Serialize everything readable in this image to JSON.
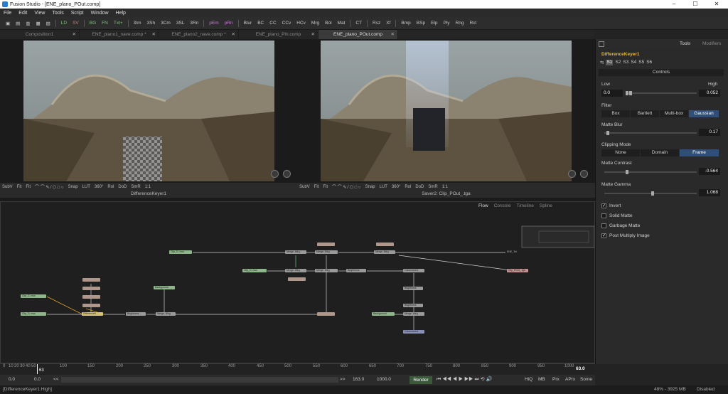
{
  "app": {
    "title": "Fusion Studio - [ENE_plano_POut.comp]"
  },
  "window_controls": [
    "–",
    "☐",
    "✕"
  ],
  "menu": [
    "File",
    "Edit",
    "View",
    "Tools",
    "Script",
    "Window",
    "Help"
  ],
  "toolbar": [
    "LD",
    "SV",
    "BG",
    "FN",
    "Txt+",
    "3Im",
    "3Sh",
    "3Cm",
    "3SL",
    "3Rn",
    "pEm",
    "pRn",
    "Blur",
    "BC",
    "CC",
    "CCv",
    "HCv",
    "Mrg",
    "Bol",
    "Mat",
    "CT",
    "Rsz",
    "Xf",
    "Bmp",
    "BSp",
    "Elp",
    "Ply",
    "Rng",
    "Rct"
  ],
  "tabs": [
    {
      "label": "Composition1"
    },
    {
      "label": "ENE_plano1_nave.comp *"
    },
    {
      "label": "ENE_plano2_nave.comp *"
    },
    {
      "label": "ENE_plano_Pln.comp"
    },
    {
      "label": "ENE_plano_POut.comp"
    }
  ],
  "viewer_left": {
    "label": "DifferenceKeyer1",
    "tools": [
      "SubV",
      "Fit",
      "Fit",
      "Snap",
      "LUT",
      "360°",
      "Rol",
      "DoD",
      "SmR",
      "1:1"
    ]
  },
  "viewer_right": {
    "label": "Saver2: Clip_POut_.tga",
    "tools": [
      "SubV",
      "Fit",
      "Fit",
      "Snap",
      "LUT",
      "360°",
      "Rol",
      "DoD",
      "SmR",
      "1:1"
    ]
  },
  "flow": {
    "tabs": [
      "Flow",
      "Console",
      "Timeline",
      "Spline"
    ],
    "nodes": [
      {
        "label": "Clip_D..mov",
        "color": "green"
      },
      {
        "label": "Clip_D..mov",
        "color": "green"
      },
      {
        "label": "Clip_D..mov",
        "color": "green"
      },
      {
        "label": "Clip_D..mov",
        "color": "green"
      },
      {
        "label": "DifferenceK...",
        "color": "yel"
      },
      {
        "label": "Brightness",
        "color": "grey"
      },
      {
        "label": "Merge..iMrg",
        "color": "grey"
      },
      {
        "label": "Background",
        "color": "green"
      },
      {
        "label": "Merge..iMrg",
        "color": "grey"
      },
      {
        "label": "Merge..iMrg",
        "color": "grey"
      },
      {
        "label": "Brightness",
        "color": "grey"
      },
      {
        "label": "Colorcorrect",
        "color": "grey"
      },
      {
        "label": "Merge..iMrg",
        "color": "grey"
      },
      {
        "label": "Merge..iMrg",
        "color": "grey"
      },
      {
        "label": "Brightness",
        "color": "grey"
      },
      {
        "label": "Background",
        "color": "green"
      },
      {
        "label": "Merge..iMrg",
        "color": "grey"
      },
      {
        "label": "Clip_POut_.tga",
        "color": "pink"
      },
      {
        "label": "ENE_Tel",
        "color": "grey"
      }
    ]
  },
  "inspector": {
    "tabs": [
      "Tools",
      "Modifiers"
    ],
    "tool_name": "DifferenceKeyer1",
    "slots": [
      "S1",
      "S2",
      "S3",
      "S4",
      "S5",
      "S6"
    ],
    "section": "Controls",
    "low_label": "Low",
    "high_label": "High",
    "low_value": "0.0",
    "high_value": "0.052",
    "filter_label": "Filter",
    "filter_options": [
      "Box",
      "Bartlett",
      "Multi-box",
      "Gaussian"
    ],
    "filter_selected": "Gaussian",
    "matte_blur_label": "Matte Blur",
    "matte_blur_value": "0.17",
    "clipping_label": "Clipping Mode",
    "clipping_options": [
      "None",
      "Domain",
      "Frame"
    ],
    "clipping_selected": "Frame",
    "matte_contrast_label": "Matte Contrast",
    "matte_contrast_value": "-0.564",
    "matte_gamma_label": "Matte Gamma",
    "matte_gamma_value": "1.068",
    "checkboxes": [
      {
        "label": "Invert",
        "checked": true
      },
      {
        "label": "Solid Matte",
        "checked": false
      },
      {
        "label": "Garbage Matte",
        "checked": false
      },
      {
        "label": "Post Multiply Image",
        "checked": true
      }
    ]
  },
  "timeline": {
    "ticks": [
      "0",
      "10",
      "20",
      "30",
      "40",
      "50",
      "100",
      "150",
      "200",
      "250",
      "300",
      "350",
      "400",
      "450",
      "500",
      "550",
      "600",
      "650",
      "700",
      "750",
      "800",
      "850",
      "900",
      "950",
      "1000"
    ],
    "current": "63",
    "current_right": "63.0"
  },
  "transport": {
    "start": "0.0",
    "in": "0.0",
    "back": "<<",
    "forward": ">>",
    "current": "163.0",
    "end": "1000.0",
    "render": "Render",
    "hiq": "HiQ",
    "mb": "MB",
    "prx": "Prx",
    "aprx": "APrx",
    "some": "Some"
  },
  "status": {
    "left": "[DifferenceKeyer1.High]",
    "mem": "48% - 3925 MB",
    "state": "Disabled"
  }
}
